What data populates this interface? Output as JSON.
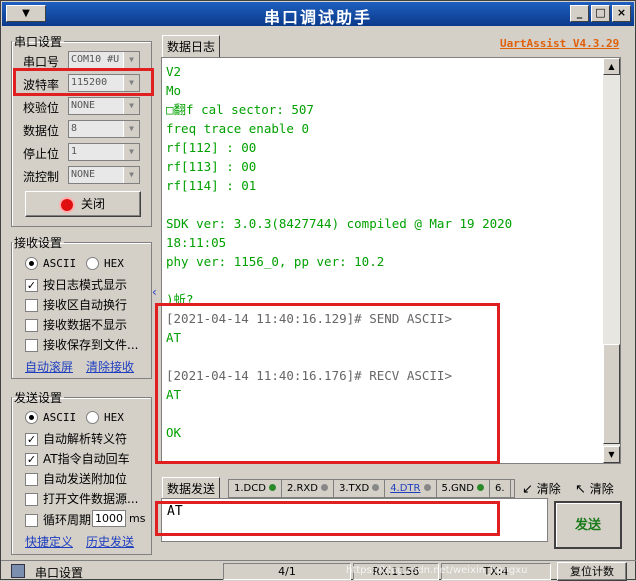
{
  "window": {
    "title": "串口调试助手",
    "sysmenu": "▼",
    "controls": [
      "_",
      "□",
      "×"
    ]
  },
  "serial": {
    "legend": "串口设置",
    "port_label": "串口号",
    "port_value": "COM10 #U",
    "baud_label": "波特率",
    "baud_value": "115200",
    "parity_label": "校验位",
    "parity_value": "NONE",
    "data_label": "数据位",
    "data_value": "8",
    "stop_label": "停止位",
    "stop_value": "1",
    "flow_label": "流控制",
    "flow_value": "NONE",
    "close_label": "关闭"
  },
  "recv": {
    "legend": "接收设置",
    "ascii": "ASCII",
    "hex": "HEX",
    "opt1": "按日志模式显示",
    "opt2": "接收区自动换行",
    "opt3": "接收数据不显示",
    "opt4": "接收保存到文件...",
    "link1": "自动滚屏",
    "link2": "清除接收"
  },
  "send": {
    "legend": "发送设置",
    "ascii": "ASCII",
    "hex": "HEX",
    "opt1": "自动解析转义符",
    "opt2": "AT指令自动回车",
    "opt3": "自动发送附加位",
    "opt4": "打开文件数据源...",
    "opt5": "循环周期",
    "period": "1000",
    "unit": "ms",
    "link1": "快捷定义",
    "link2": "历史发送"
  },
  "brand": "UartAssist V4.3.29",
  "log_tab": "数据日志",
  "log_lines": [
    {
      "t": "V2",
      "c": "g"
    },
    {
      "t": "Mo",
      "c": "g"
    },
    {
      "t": "□翻f cal sector: 507",
      "c": "g"
    },
    {
      "t": "freq trace enable 0",
      "c": "g"
    },
    {
      "t": "rf[112] : 00",
      "c": "g"
    },
    {
      "t": "rf[113] : 00",
      "c": "g"
    },
    {
      "t": "rf[114] : 01",
      "c": "g"
    },
    {
      "t": "",
      "c": "g"
    },
    {
      "t": "SDK ver: 3.0.3(8427744) compiled @ Mar 19 2020",
      "c": "g"
    },
    {
      "t": "18:11:05",
      "c": "g"
    },
    {
      "t": "phy ver: 1156_0, pp ver: 10.2",
      "c": "g"
    },
    {
      "t": "",
      "c": "g"
    },
    {
      "t": ")蚯?",
      "c": "g"
    },
    {
      "t": "[2021-04-14 11:40:16.129]# SEND ASCII>",
      "c": "k"
    },
    {
      "t": "AT",
      "c": "g"
    },
    {
      "t": "",
      "c": "g"
    },
    {
      "t": "[2021-04-14 11:40:16.176]# RECV ASCII>",
      "c": "k"
    },
    {
      "t": "AT",
      "c": "g"
    },
    {
      "t": "",
      "c": "g"
    },
    {
      "t": "OK",
      "c": "g"
    }
  ],
  "sendbar": {
    "tab": "数据发送",
    "pins": [
      "1.DCD",
      "2.RXD",
      "3.TXD",
      "4.DTR",
      "5.GND",
      "6."
    ],
    "clear1": "清除",
    "clear2": "清除"
  },
  "send_text": "AT",
  "send_button": "发送",
  "statusbar": {
    "label": "串口设置",
    "page": "4/1",
    "rx": "RX:1156",
    "tx": "TX:4",
    "reset": "复位计数",
    "watermark": "https://blog.csdn.net/weixin_hongxu"
  }
}
